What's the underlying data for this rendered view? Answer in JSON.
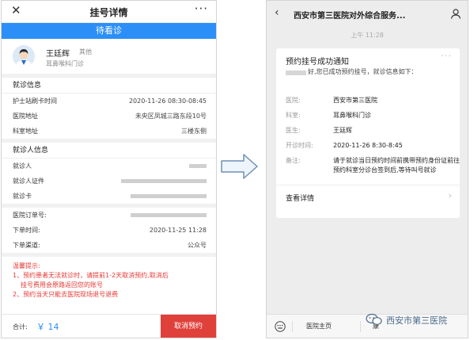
{
  "left": {
    "nav": {
      "title": "挂号详情",
      "close": "✕",
      "more": "···"
    },
    "status": "待看诊",
    "doctor": {
      "name": "王廷辉",
      "tag": "其他",
      "dept": "耳鼻喉科门诊"
    },
    "visit": {
      "title": "就诊信息",
      "rows": [
        {
          "label": "护士站刷卡时间",
          "value": "2020-11-26 08:30-08:45"
        },
        {
          "label": "医院地址",
          "value": "未央区凤城三路东段10号"
        },
        {
          "label": "科室地址",
          "value": "三楼东侧"
        }
      ]
    },
    "patient": {
      "title": "就诊人信息",
      "rows": [
        {
          "label": "就诊人",
          "value": ""
        },
        {
          "label": "就诊人证件",
          "value": ""
        },
        {
          "label": "就诊卡",
          "value": ""
        }
      ]
    },
    "order": {
      "rows": [
        {
          "label": "医院订单号:",
          "value": ""
        },
        {
          "label": "下单时间:",
          "value": "2020-11-25 11:28"
        },
        {
          "label": "下单渠道:",
          "value": "公众号"
        }
      ]
    },
    "tips": {
      "title": "温馨提示:",
      "line1": "1、预约患者无法就诊时，请提前1-2天取消预约,取消后",
      "line1b": "挂号费用会原路返回您的账号",
      "line2": "2、预约当天只能去医院现场退号退费"
    },
    "footer": {
      "total_label": "合计:",
      "total_value": "￥ 14",
      "cancel": "取消预约"
    }
  },
  "right": {
    "nav": {
      "title": "西安市第三医院对外综合服务...",
      "back": "‹"
    },
    "time": "上午 11:28",
    "card": {
      "title": "预约挂号成功通知",
      "more": "···",
      "greeting": "好,您已成功预约挂号，就诊信息如下：",
      "rows": [
        {
          "label": "医院:",
          "value": "西安市第三医院"
        },
        {
          "label": "科室:",
          "value": "耳鼻喉科门诊"
        },
        {
          "label": "医生:",
          "value": "王廷辉"
        },
        {
          "label": "开诊时间:",
          "value": "2020-11-26 8:30-8:45"
        },
        {
          "label": "备注:",
          "value": "请于就诊当日预约时间前携带预约身份证前往预约科室分诊台签到后,等待叫号就诊"
        }
      ],
      "detail": "查看详情",
      "chevron": "›"
    },
    "bottom": {
      "menu1": "医院主页",
      "menu2": "康"
    }
  },
  "watermark": "西安市第三医院",
  "colors": {
    "primary_blue": "#2b8ff7",
    "cancel_red": "#e0403a",
    "tip_red": "#e53935"
  }
}
